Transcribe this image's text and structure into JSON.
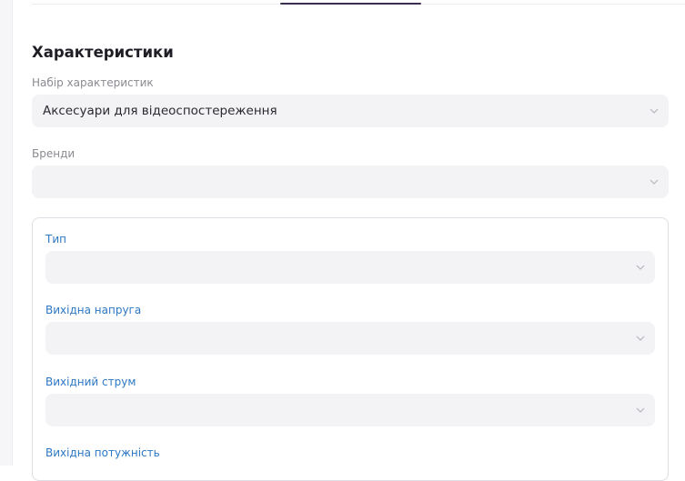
{
  "section": {
    "title": "Характеристики"
  },
  "fields": {
    "feature_set": {
      "label": "Набір характеристик",
      "value": "Аксесуари для відеоспостереження"
    },
    "brands": {
      "label": "Бренди",
      "value": ""
    }
  },
  "group": {
    "items": [
      {
        "label": "Тип",
        "value": ""
      },
      {
        "label": "Вихідна напруга",
        "value": ""
      },
      {
        "label": "Вихідний струм",
        "value": ""
      },
      {
        "label": "Вихідна потужність",
        "value": ""
      }
    ]
  },
  "icons": {
    "dropdown": "chevron-down-icon"
  },
  "colors": {
    "accent_label": "#2d78c4",
    "tab_indicator": "#3a2e4f",
    "field_bg": "#f3f3f6"
  }
}
